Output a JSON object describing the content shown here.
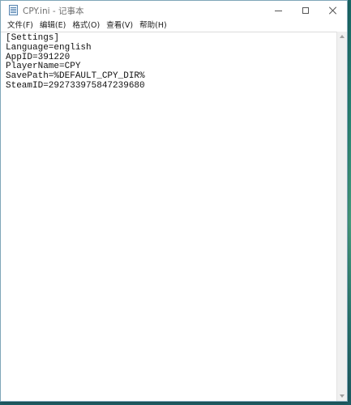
{
  "window": {
    "title": "CPY.ini - 记事本"
  },
  "menu": {
    "items": [
      {
        "label": "文件(F)"
      },
      {
        "label": "编辑(E)"
      },
      {
        "label": "格式(O)"
      },
      {
        "label": "查看(V)"
      },
      {
        "label": "帮助(H)"
      }
    ]
  },
  "editor": {
    "lines": [
      "[Settings]",
      "Language=english",
      "AppID=391220",
      "PlayerName=CPY",
      "SavePath=%DEFAULT_CPY_DIR%",
      "SteamID=292733975847239680"
    ]
  },
  "icons": {
    "app": "notepad-icon",
    "minimize": "minimize-icon",
    "maximize": "maximize-icon",
    "close": "close-icon"
  },
  "colors": {
    "desktop_accent": "#2c8c7a",
    "text": "#111111"
  }
}
